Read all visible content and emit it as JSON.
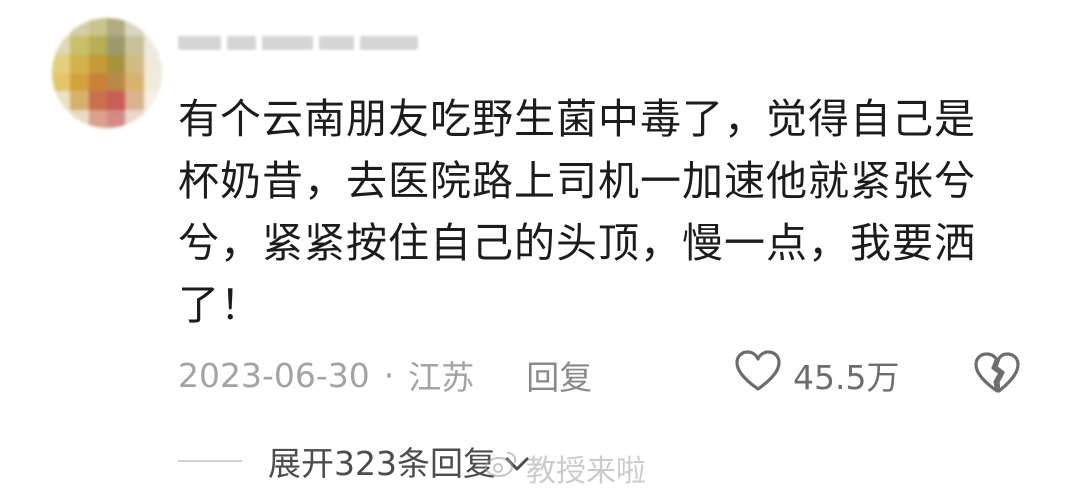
{
  "comment": {
    "avatar_colors": [
      "#e9e9e3",
      "#d4cfa6",
      "#c9c48b",
      "#b1ab7f",
      "#d9d6c0",
      "#f0f0ec",
      "#ddd8b3",
      "#c9bf6b",
      "#b8ae55",
      "#9c9a6d",
      "#c8c09a",
      "#ece9df",
      "#e0cf7c",
      "#d2b24a",
      "#c69a39",
      "#a7923e",
      "#d0bc82",
      "#efeadc",
      "#e4c66a",
      "#d4a23d",
      "#c8823a",
      "#b78a46",
      "#d9b36d",
      "#f1ebde",
      "#e9e2c3",
      "#d7b06b",
      "#c96f4e",
      "#c95d58",
      "#dcb38e",
      "#f3efe6",
      "#f2f1ec",
      "#e8dbc2",
      "#d9a08b",
      "#d38b84",
      "#ead7cc",
      "#f6f5f2"
    ],
    "text_lines": [
      "有个云南朋友吃野生菌中毒了，觉得自己是",
      "杯奶昔，去医院路上司机一加速他就紧张兮",
      "兮，紧紧按住自己的头顶，慢一点，我要洒",
      "了！"
    ],
    "date": "2023-06-30",
    "separator": "·",
    "location": "江苏",
    "reply_label": "回复",
    "like_icon": "heart-outline-icon",
    "like_count": "45.5万",
    "dislike_icon": "broken-heart-icon",
    "expand_label": "展开323条回复",
    "expand_icon": "chevron-down-icon"
  },
  "watermark": {
    "icon": "weibo-logo-icon",
    "text": "教授来啦"
  }
}
